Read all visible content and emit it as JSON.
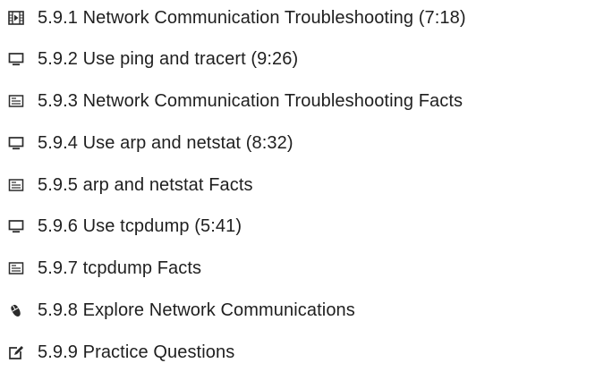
{
  "lessons": [
    {
      "icon": "video-icon",
      "label": "5.9.1 Network Communication Troubleshooting (7:18)"
    },
    {
      "icon": "monitor-icon",
      "label": "5.9.2 Use ping and tracert (9:26)"
    },
    {
      "icon": "document-icon",
      "label": "5.9.3 Network Communication Troubleshooting Facts"
    },
    {
      "icon": "monitor-icon",
      "label": "5.9.4 Use arp and netstat (8:32)"
    },
    {
      "icon": "document-icon",
      "label": "5.9.5 arp and netstat Facts"
    },
    {
      "icon": "monitor-icon",
      "label": "5.9.6 Use tcpdump (5:41)"
    },
    {
      "icon": "document-icon",
      "label": "5.9.7 tcpdump Facts"
    },
    {
      "icon": "mouse-icon",
      "label": "5.9.8 Explore Network Communications"
    },
    {
      "icon": "quiz-icon",
      "label": "5.9.9 Practice Questions"
    }
  ],
  "colors": {
    "text": "#1f1f1f",
    "icon": "#2b2b2b",
    "background": "#ffffff"
  }
}
